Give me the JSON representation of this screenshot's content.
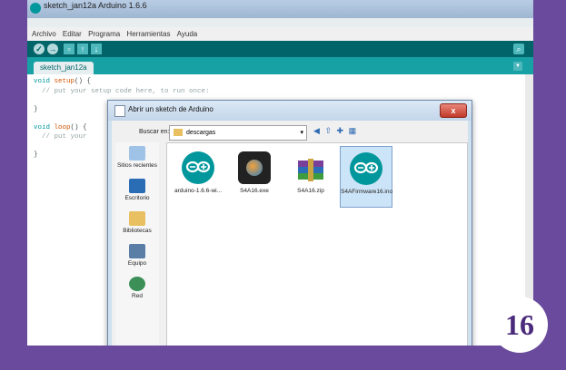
{
  "window": {
    "title": "sketch_jan12a Arduino 1.6.6"
  },
  "menu": [
    "Archivo",
    "Editar",
    "Programa",
    "Herramientas",
    "Ayuda"
  ],
  "tab": {
    "label": "sketch_jan12a"
  },
  "code": {
    "l1_kw": "void",
    "l1_fn": "setup",
    "l1_rest": "() {",
    "l2": "  // put your setup code here, to run once:",
    "l3": "}",
    "l4_kw": "void",
    "l4_fn": "loop",
    "l4_rest": "() {",
    "l5": "  // put your",
    "l6": "}"
  },
  "dialog": {
    "title": "Abrir un sketch de Arduino",
    "close_label": "x",
    "lookin_label": "Buscar en:",
    "lookin_value": "descargas",
    "places": [
      "Sitios recientes",
      "Escritorio",
      "Bibliotecas",
      "Equipo",
      "Red"
    ],
    "files": [
      {
        "name": "arduino-1.6.6-wi...",
        "icon": "arduino-icon"
      },
      {
        "name": "S4A16.exe",
        "icon": "s4a-icon"
      },
      {
        "name": "S4A16.zip",
        "icon": "winrar-icon"
      },
      {
        "name": "S4AFirmware16.ino",
        "icon": "arduino-icon",
        "selected": true
      }
    ]
  },
  "badge": "16",
  "colors": {
    "background": "#6a4a9c",
    "arduino_teal": "#00979c",
    "toolbar": "#006468"
  }
}
